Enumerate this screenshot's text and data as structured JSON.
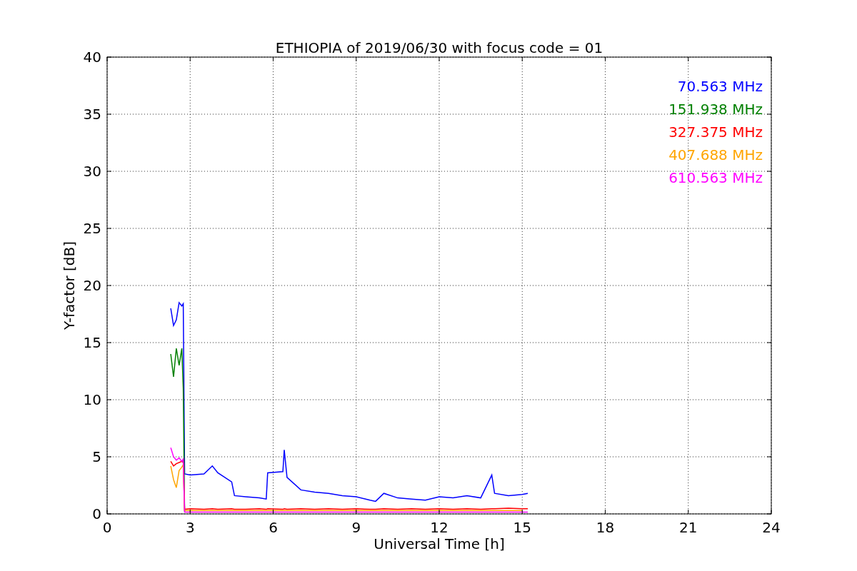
{
  "chart_data": {
    "type": "line",
    "title": "ETHIOPIA of 2019/06/30 with focus code = 01",
    "xlabel": "Universal Time [h]",
    "ylabel": "Y-factor [dB]",
    "x": [
      2.3,
      2.4,
      2.5,
      2.6,
      2.7,
      2.75,
      2.8,
      3.0,
      3.5,
      3.8,
      4.0,
      4.5,
      4.6,
      5.0,
      5.5,
      5.75,
      5.8,
      6.35,
      6.4,
      6.5,
      7,
      7.5,
      8,
      8.5,
      9,
      9.5,
      9.7,
      10,
      10.5,
      11,
      11.5,
      12,
      12.5,
      13,
      13.5,
      13.9,
      14,
      14.5,
      15,
      15.2
    ],
    "series": [
      {
        "name": "70.563 MHz",
        "color": "#0000ff",
        "values": [
          18,
          16.5,
          17,
          18.5,
          18.2,
          18.4,
          3.5,
          3.4,
          3.5,
          4.2,
          3.6,
          2.8,
          1.6,
          1.5,
          1.4,
          1.3,
          3.6,
          3.7,
          5.6,
          3.2,
          2.1,
          1.9,
          1.8,
          1.6,
          1.5,
          1.2,
          1.1,
          1.8,
          1.4,
          1.3,
          1.2,
          1.5,
          1.4,
          1.6,
          1.4,
          3.4,
          1.8,
          1.6,
          1.7,
          1.8
        ]
      },
      {
        "name": "151.938 MHz",
        "color": "#008000",
        "values": [
          14,
          12,
          14.5,
          13,
          14.5,
          11,
          0.2,
          null,
          null,
          null,
          null,
          null,
          null,
          null,
          null,
          null,
          null,
          null,
          null,
          null,
          null,
          null,
          null,
          null,
          null,
          null,
          null,
          null,
          null,
          null,
          null,
          null,
          null,
          null,
          null,
          null,
          null,
          null,
          null,
          null
        ]
      },
      {
        "name": "327.375 MHz",
        "color": "#ff0000",
        "values": [
          4.6,
          4.2,
          4.4,
          4.5,
          4.6,
          4.5,
          0.4,
          0.45,
          0.4,
          0.45,
          0.4,
          0.45,
          0.4,
          0.4,
          0.45,
          0.4,
          0.45,
          0.4,
          0.45,
          0.4,
          0.45,
          0.4,
          0.45,
          0.4,
          0.45,
          0.4,
          0.4,
          0.45,
          0.4,
          0.45,
          0.4,
          0.45,
          0.4,
          0.45,
          0.4,
          0.45,
          0.45,
          0.5,
          0.45,
          0.45
        ]
      },
      {
        "name": "407.688 MHz",
        "color": "#ffa500",
        "values": [
          4.2,
          3,
          2.3,
          3.8,
          4.1,
          4.3,
          0.3,
          0.3,
          0.3,
          0.3,
          0.3,
          0.3,
          0.3,
          0.3,
          0.3,
          0.3,
          0.3,
          0.3,
          0.3,
          0.3,
          0.3,
          0.3,
          0.3,
          0.3,
          0.3,
          0.3,
          0.3,
          0.3,
          0.3,
          0.3,
          0.3,
          0.3,
          0.3,
          0.3,
          0.3,
          0.3,
          0.3,
          0.3,
          0.3,
          null
        ]
      },
      {
        "name": "610.563 MHz",
        "color": "#ff00ff",
        "values": [
          5.8,
          5,
          4.7,
          4.9,
          4.6,
          4.8,
          0.15,
          0.15,
          0.15,
          0.15,
          0.15,
          0.15,
          0.15,
          0.15,
          0.15,
          0.15,
          0.15,
          0.15,
          0.15,
          0.15,
          0.15,
          0.15,
          0.15,
          0.15,
          0.15,
          0.15,
          0.15,
          0.15,
          0.15,
          0.15,
          0.15,
          0.15,
          0.15,
          0.15,
          0.15,
          0.15,
          0.15,
          0.15,
          0.15,
          0.15
        ]
      }
    ],
    "grid": true,
    "xlim": [
      0,
      24
    ],
    "ylim": [
      0,
      40
    ],
    "xticks": [
      0,
      3,
      6,
      9,
      12,
      15,
      18,
      21,
      24
    ],
    "yticks": [
      0,
      5,
      10,
      15,
      20,
      25,
      30,
      35,
      40
    ]
  }
}
